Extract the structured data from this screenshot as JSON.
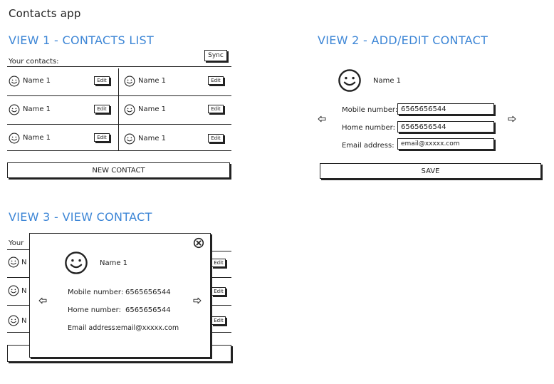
{
  "app": {
    "title": "Contacts app"
  },
  "view1": {
    "title": "VIEW 1 - CONTACTS LIST",
    "section_label": "Your contacts:",
    "sync_label": "Sync",
    "edit_label": "Edit",
    "new_contact_label": "NEW CONTACT",
    "contacts": [
      "Name 1",
      "Name 1",
      "Name 1",
      "Name 1",
      "Name 1",
      "Name 1"
    ]
  },
  "view2": {
    "title": "VIEW 2 - ADD/EDIT CONTACT",
    "name": "Name 1",
    "mobile_label": "Mobile number:",
    "mobile_value": "6565656544",
    "home_label": "Home number:",
    "home_value": "6565656544",
    "email_label": "Email address:",
    "email_value": "email@xxxxx.com",
    "save_label": "SAVE"
  },
  "view3": {
    "title": "VIEW 3 - VIEW CONTACT",
    "background_label": "Your",
    "edit_label": "Edit",
    "name": "Name 1",
    "mobile_label": "Mobile number:",
    "mobile_value": "6565656544",
    "home_label": "Home number:",
    "home_value": "6565656544",
    "email_label": "Email address:",
    "email_value": "email@xxxxx.com"
  },
  "icons": {
    "smiley": "smiley-icon",
    "left_arrow": "arrow-left-icon",
    "right_arrow": "arrow-right-icon",
    "close": "close-icon"
  }
}
